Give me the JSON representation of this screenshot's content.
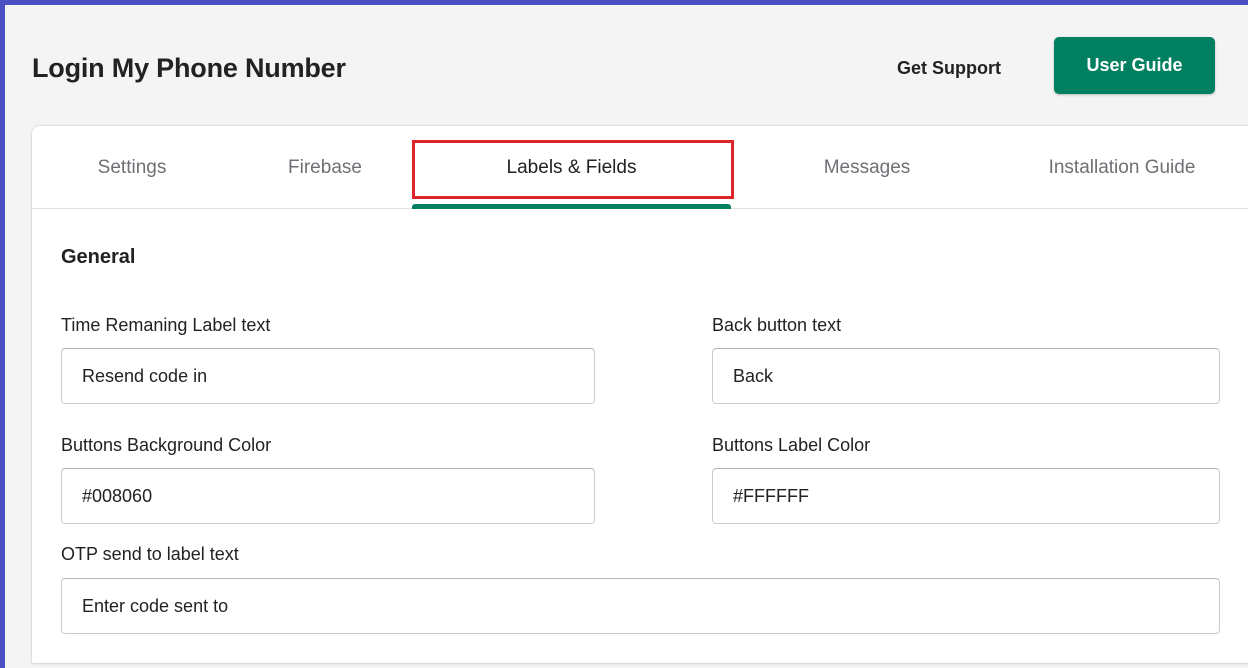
{
  "header": {
    "app_title": "Login My Phone Number",
    "get_support_label": "Get Support",
    "user_guide_label": "User Guide"
  },
  "tabs": [
    {
      "label": "Settings",
      "active": false
    },
    {
      "label": "Firebase",
      "active": false
    },
    {
      "label": "Labels & Fields",
      "active": true
    },
    {
      "label": "Messages",
      "active": false
    },
    {
      "label": "Installation Guide",
      "active": false
    }
  ],
  "section": {
    "title": "General"
  },
  "fields": {
    "time_remaining": {
      "label": "Time Remaning Label text",
      "value": "Resend code in"
    },
    "back_button": {
      "label": "Back button text",
      "value": "Back"
    },
    "buttons_bg_color": {
      "label": "Buttons Background Color",
      "value": "#008060"
    },
    "buttons_label_color": {
      "label": "Buttons Label Color",
      "value": "#FFFFFF"
    },
    "otp_send_to": {
      "label": "OTP send to label text",
      "value": "Enter code sent to"
    }
  },
  "colors": {
    "brand": "#008060",
    "highlight": "#e0242b",
    "frame": "#4a4fc4"
  }
}
